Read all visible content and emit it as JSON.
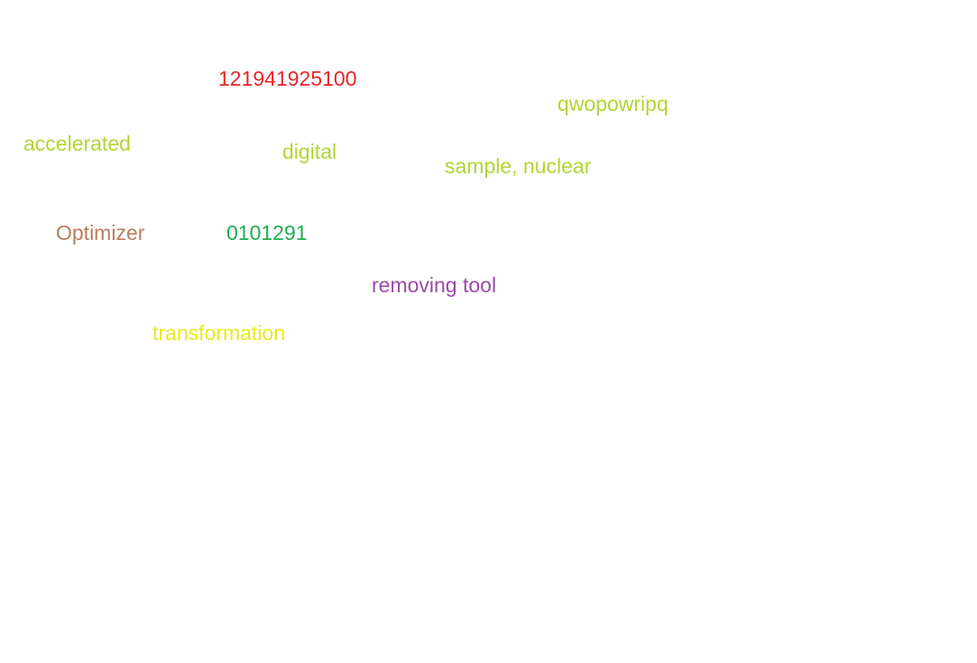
{
  "words": [
    {
      "key": "number_top",
      "text": "121941925100",
      "color": "#e8262a"
    },
    {
      "key": "qwopowripq",
      "text": "qwopowripq",
      "color": "#b0d631"
    },
    {
      "key": "accelerated",
      "text": "accelerated",
      "color": "#b0d631"
    },
    {
      "key": "digital",
      "text": "digital",
      "color": "#b0d631"
    },
    {
      "key": "sample_nuclear",
      "text": "sample, nuclear",
      "color": "#b0d631"
    },
    {
      "key": "optimizer",
      "text": "Optimizer",
      "color": "#b87e5c"
    },
    {
      "key": "number_green",
      "text": "0101291",
      "color": "#1fae52"
    },
    {
      "key": "removing_tool",
      "text": "removing tool",
      "color": "#9b4aa8"
    },
    {
      "key": "transformation",
      "text": "transformation",
      "color": "#e8ea1a"
    }
  ]
}
